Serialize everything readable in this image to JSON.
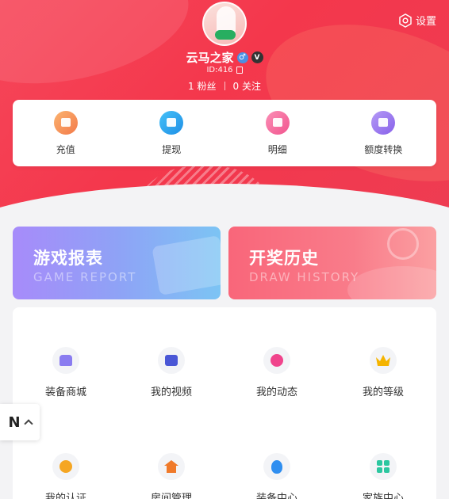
{
  "header": {
    "settings_label": "设置",
    "username": "云马之家",
    "gender_symbol": "♂",
    "vip_symbol": "V",
    "id_text": "ID:416",
    "fans": "1 粉丝",
    "follows": "0 关注"
  },
  "wallet": [
    {
      "label": "充值",
      "color": "#f59a5b"
    },
    {
      "label": "提现",
      "color": "#2ba6f0"
    },
    {
      "label": "明细",
      "color": "#f56fa0"
    },
    {
      "label": "额度转换",
      "color": "#a07cf0"
    }
  ],
  "banners": {
    "game": {
      "title": "游戏报表",
      "subtitle": "GAME REPORT"
    },
    "draw": {
      "title": "开奖历史",
      "subtitle": "DRAW HISTORY"
    }
  },
  "menu": [
    {
      "label": "装备商城",
      "icon": "store-icon",
      "color": "#8a7cf0"
    },
    {
      "label": "我的视频",
      "icon": "video-icon",
      "color": "#4a57d6"
    },
    {
      "label": "我的动态",
      "icon": "moments-icon",
      "color": "#f0448c"
    },
    {
      "label": "我的等级",
      "icon": "crown-icon",
      "color": "#f5b400"
    },
    {
      "label": "我的认证",
      "icon": "certification-icon",
      "color": "#f5a623"
    },
    {
      "label": "房间管理",
      "icon": "house-icon",
      "color": "#f07a2a"
    },
    {
      "label": "装备中心",
      "icon": "balloon-icon",
      "color": "#2f8ef0"
    },
    {
      "label": "家族中心",
      "icon": "family-grid-icon",
      "color": "#2cc7a0"
    }
  ],
  "float_button": {
    "label": "N"
  }
}
